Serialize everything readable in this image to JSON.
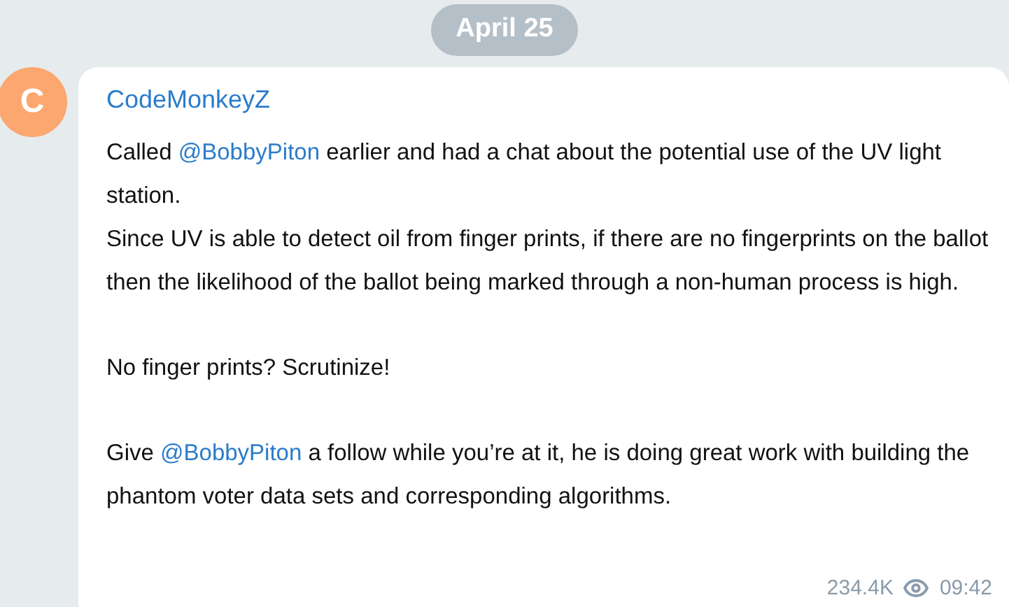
{
  "date_badge": "April 25",
  "message": {
    "avatar_letter": "C",
    "author": "CodeMonkeyZ",
    "blocks": [
      [
        [
          {
            "kind": "text",
            "text": "Called "
          },
          {
            "kind": "mention",
            "text": "@BobbyPiton"
          },
          {
            "kind": "text",
            "text": " earlier and had a chat about the potential use of the UV light station."
          }
        ],
        [
          {
            "kind": "text",
            "text": "Since UV is able to detect oil from finger prints, if there are no fingerprints on the ballot then the likelihood of the ballot being marked through a non-human process is high."
          }
        ]
      ],
      [
        [
          {
            "kind": "text",
            "text": "No finger prints? Scrutinize!"
          }
        ]
      ],
      [
        [
          {
            "kind": "text",
            "text": "Give "
          },
          {
            "kind": "mention",
            "text": "@BobbyPiton"
          },
          {
            "kind": "text",
            "text": " a follow while you’re at it, he is doing great work with building the phantom voter data sets and corresponding algorithms."
          }
        ]
      ]
    ],
    "views": "234.4K",
    "time": "09:42"
  }
}
